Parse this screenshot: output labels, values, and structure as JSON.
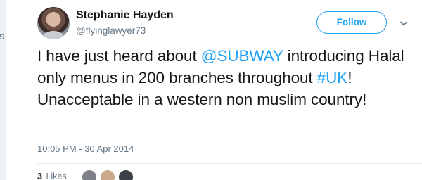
{
  "tweet": {
    "author": {
      "name": "Stephanie Hayden",
      "handle": "@flyinglawyer73"
    },
    "follow_label": "Follow",
    "text_parts": {
      "p1": "I have just heard about ",
      "mention": "@SUBWAY",
      "p2": " introducing Halal only menus in 200 branches throughout ",
      "hashtag": "#UK",
      "p3": "! Unacceptable in a western non muslim country!"
    },
    "timestamp": "10:05 PM - 30 Apr 2014",
    "stats": {
      "likes_count": "3",
      "likes_label": "Likes"
    },
    "colors": {
      "link": "#1da1f2",
      "text": "#14171a",
      "muted": "#657786"
    }
  }
}
